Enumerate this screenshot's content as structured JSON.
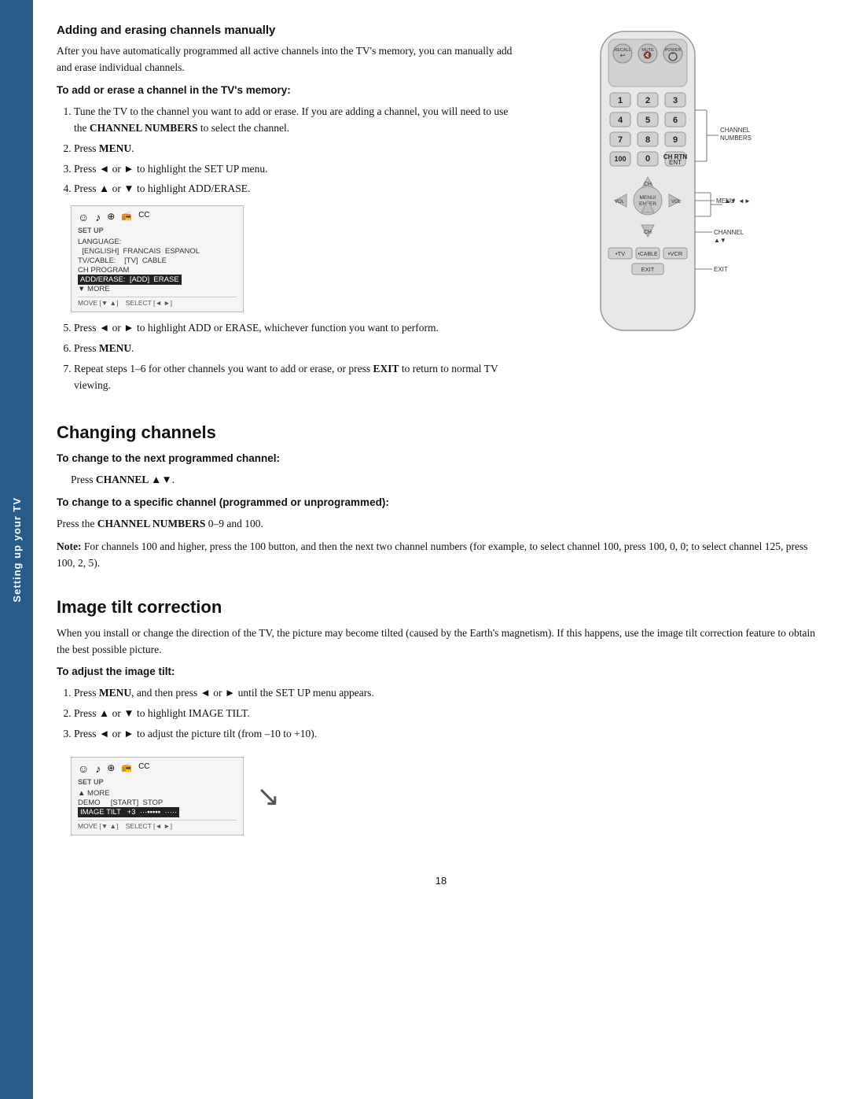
{
  "sidebar": {
    "text": "Setting up your TV"
  },
  "page_number": "18",
  "section1": {
    "heading": "Adding and erasing channels manually",
    "intro": "After you have automatically programmed all active channels into the TV's memory, you can manually add and erase individual channels.",
    "bold_instruction": "To add or erase a channel in the TV's memory:",
    "steps": [
      "Tune the TV to the channel you want to add or erase. If you are adding a channel, you will need to use the CHANNEL NUMBERS to select the channel.",
      "Press MENU.",
      "Press ◄ or ► to highlight the SET UP menu.",
      "Press ▲ or ▼ to highlight ADD/ERASE.",
      "Press ◄ or ► to highlight ADD or ERASE, whichever function you want to perform.",
      "Press MENU.",
      "Repeat steps 1–6 for other channels you want to add or erase, or press EXIT to return to normal TV viewing."
    ],
    "menu_labels": {
      "title": "SET UP",
      "icons": [
        "☺",
        "♪",
        "⊕",
        "CC",
        "CC"
      ],
      "rows": [
        "LANGUAGE:",
        "[ENGLISH]  FRANCAIS  ESPANOL",
        "TV/CABLE:    [TV]  CABLE",
        "CH PROGRAM",
        "ADD/ERASE:   [ADD]  ERASE",
        "▼ MORE"
      ],
      "footer": "MOVE [▼ ▲]    SELECT [◄ ►]"
    }
  },
  "section2": {
    "heading": "Changing channels",
    "sub1_bold": "To change to the next programmed channel:",
    "sub1_text": "Press CHANNEL ▲▼.",
    "sub2_bold": "To change to a specific channel (programmed or unprogrammed):",
    "sub2_text": "Press the CHANNEL NUMBERS 0–9 and 100.",
    "note_bold": "Note:",
    "note_text": " For channels 100 and higher, press the 100 button, and then the next two channel numbers (for example, to select channel 100, press 100, 0, 0; to select channel 125, press 100, 2, 5)."
  },
  "section3": {
    "heading": "Image tilt correction",
    "intro": "When you install or change the direction of the TV, the picture may become tilted (caused by the Earth's magnetism). If this happens, use the image tilt correction feature to obtain the best possible picture.",
    "bold_instruction": "To adjust the image tilt:",
    "steps": [
      "Press MENU, and then press ◄ or ► until the SET UP menu appears.",
      "Press ▲ or ▼ to highlight IMAGE TILT.",
      "Press ◄ or ► to adjust the picture tilt (from –10 to +10)."
    ],
    "menu_labels": {
      "title": "SET UP",
      "rows": [
        "▲ MORE",
        "DEMO     [START]  STOP",
        "IMAGE TILT    +3  ···▪▪▪▪▪  ·····"
      ],
      "footer": "MOVE [▼ ▲]    SELECT [◄ ►]"
    }
  },
  "remote": {
    "labels": {
      "channel_numbers": "CHANNEL\nNUMBERS",
      "menu": "MENU",
      "nav": "▲▼ ◄►",
      "channel_updown": "CHANNEL\n▲▼",
      "exit": "EXIT"
    },
    "buttons": {
      "recall": "RECALL",
      "mute": "MUTE",
      "power": "POWER",
      "b1": "1",
      "b2": "2",
      "b3": "3",
      "b4": "4",
      "b5": "5",
      "b6": "6",
      "b7": "7",
      "b8": "8",
      "b9": "9",
      "b100": "100",
      "b0": "0",
      "ent": "ENT",
      "ch_rtn": "CH RTN",
      "vol_left": "◄",
      "vol_right": "►",
      "ch_up": "▲",
      "ch_down": "▼",
      "menu_enter": "MENU/\nENTER",
      "tv": "TV",
      "cable": "CABLE",
      "vcr": "VCR",
      "exit": "EXIT"
    }
  }
}
